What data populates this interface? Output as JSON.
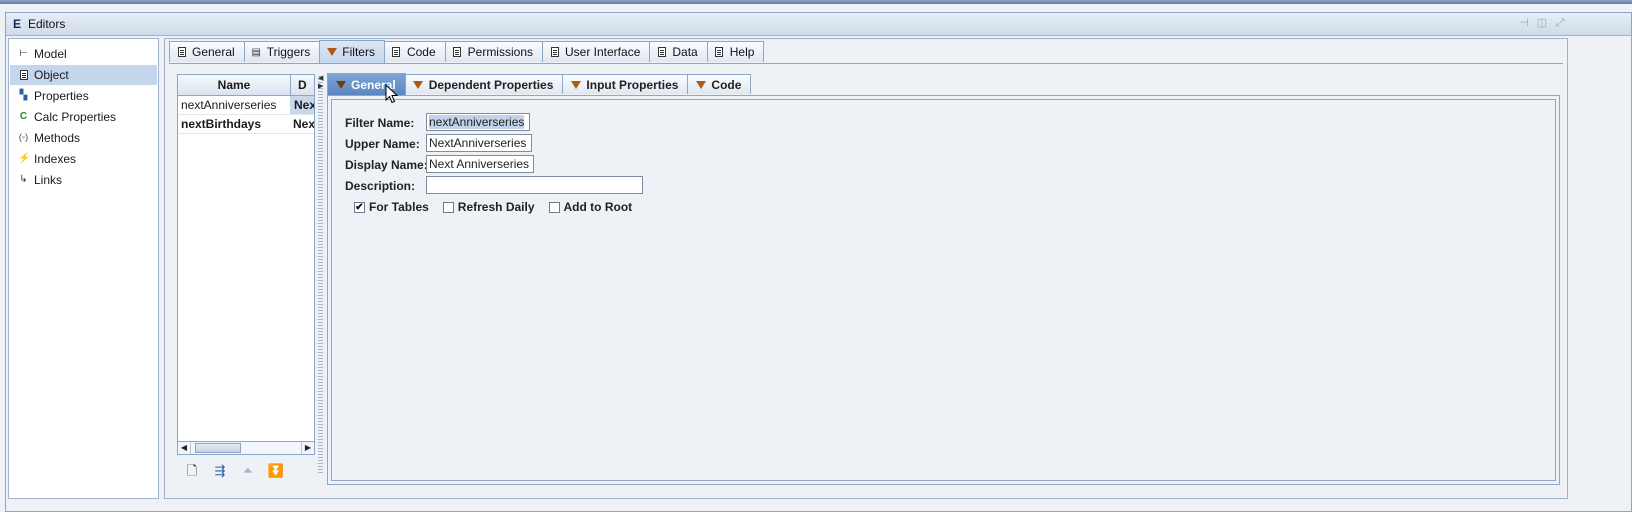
{
  "window": {
    "title": "Editors",
    "app_icon": "E"
  },
  "tree": {
    "items": [
      {
        "label": "Model",
        "icon": "model-icon",
        "selected": false
      },
      {
        "label": "Object",
        "icon": "object-icon",
        "selected": true
      },
      {
        "label": "Properties",
        "icon": "properties-icon",
        "selected": false
      },
      {
        "label": "Calc Properties",
        "icon": "calc-properties-icon",
        "selected": false
      },
      {
        "label": "Methods",
        "icon": "methods-icon",
        "selected": false
      },
      {
        "label": "Indexes",
        "icon": "indexes-icon",
        "selected": false
      },
      {
        "label": "Links",
        "icon": "links-icon",
        "selected": false
      }
    ]
  },
  "tabs": [
    {
      "label": "General",
      "icon": "doc-icon"
    },
    {
      "label": "Triggers",
      "icon": "triggers-icon"
    },
    {
      "label": "Filters",
      "icon": "filter-icon",
      "active": true
    },
    {
      "label": "Code",
      "icon": "doc-icon"
    },
    {
      "label": "Permissions",
      "icon": "doc-icon"
    },
    {
      "label": "User Interface",
      "icon": "doc-icon"
    },
    {
      "label": "Data",
      "icon": "doc-icon"
    },
    {
      "label": "Help",
      "icon": "doc-icon"
    }
  ],
  "filter_list": {
    "columns": [
      "Name",
      "D"
    ],
    "rows": [
      {
        "name": "nextAnniverseries",
        "display": "Nex"
      },
      {
        "name": "nextBirthdays",
        "display": "Nex"
      }
    ]
  },
  "inner_tabs": [
    {
      "label": "General",
      "active": true
    },
    {
      "label": "Dependent Properties"
    },
    {
      "label": "Input Properties"
    },
    {
      "label": "Code"
    }
  ],
  "form": {
    "filter_name_label": "Filter Name:",
    "filter_name_value": "nextAnniverseries",
    "upper_name_label": "Upper Name:",
    "upper_name_value": "NextAnniverseries",
    "display_name_label": "Display Name:",
    "display_name_value": "Next Anniverseries",
    "description_label": "Description:",
    "description_value": "",
    "for_tables_label": "For Tables",
    "for_tables_checked": true,
    "refresh_daily_label": "Refresh Daily",
    "refresh_daily_checked": false,
    "add_to_root_label": "Add to Root",
    "add_to_root_checked": false
  },
  "colors": {
    "accent": "#5b86c2",
    "selection": "#c5d6ec",
    "border": "#8ea6c6"
  }
}
